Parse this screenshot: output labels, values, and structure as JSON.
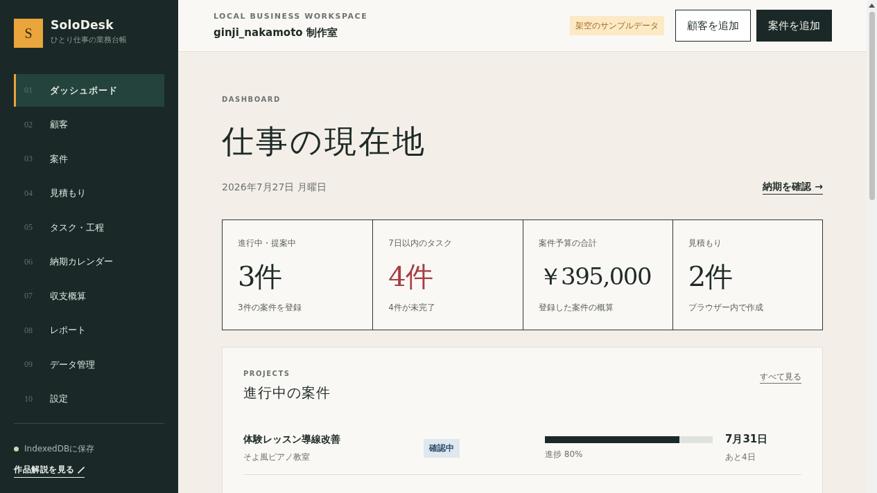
{
  "sidebar": {
    "logo": {
      "letter": "S",
      "name": "SoloDesk",
      "tagline": "ひとり仕事の業務台帳"
    },
    "nav_items": [
      {
        "number": "01",
        "label": "ダッシュボード",
        "selected": true
      },
      {
        "number": "02",
        "label": "顧客",
        "selected": false
      },
      {
        "number": "03",
        "label": "案件",
        "selected": false
      },
      {
        "number": "04",
        "label": "見積もり",
        "selected": false
      },
      {
        "number": "05",
        "label": "タスク・工程",
        "selected": false
      },
      {
        "number": "06",
        "label": "納期カレンダー",
        "selected": false
      },
      {
        "number": "07",
        "label": "収支概算",
        "selected": false
      },
      {
        "number": "08",
        "label": "レポート",
        "selected": false
      },
      {
        "number": "09",
        "label": "データ管理",
        "selected": false
      },
      {
        "number": "10",
        "label": "設定",
        "selected": false
      }
    ],
    "storage_status": "IndexedDBに保存",
    "link": "作品解説を見る"
  },
  "header": {
    "eyebrow": "LOCAL BUSINESS WORKSPACE",
    "workspace": "ginji_nakamoto 制作室",
    "badge": "架空のサンプルデータ",
    "buttons": [
      {
        "label": "顧客を追加",
        "kind": "outline"
      },
      {
        "label": "案件を追加",
        "kind": "primary"
      }
    ]
  },
  "page": {
    "eyebrow": "DASHBOARD",
    "title": "仕事の現在地",
    "date": "2026年7月27日 月曜日",
    "link": "納期を確認 →"
  },
  "stats": [
    {
      "label": "進行中・提案中",
      "value": "3件",
      "note": "3件の案件を登録",
      "alert": false
    },
    {
      "label": "7日以内のタスク",
      "value": "4件",
      "note": "4件が未完了",
      "alert": true
    },
    {
      "label": "案件予算の合計",
      "value": "￥395,000",
      "note": "登録した案件の概算",
      "alert": false
    },
    {
      "label": "見積もり",
      "value": "2件",
      "note": "ブラウザー内で作成",
      "alert": false
    }
  ],
  "projects": {
    "eyebrow": "PROJECTS",
    "title": "進行中の案件",
    "link": "すべて見る",
    "rows": [
      {
        "name": "体験レッスン導線改善",
        "client": "そよ風ピアノ教室",
        "status": "確認中",
        "level": 0.8,
        "progress_label": "進捗 80%",
        "due": "7月31日",
        "remaining": "あと4日"
      }
    ]
  }
}
